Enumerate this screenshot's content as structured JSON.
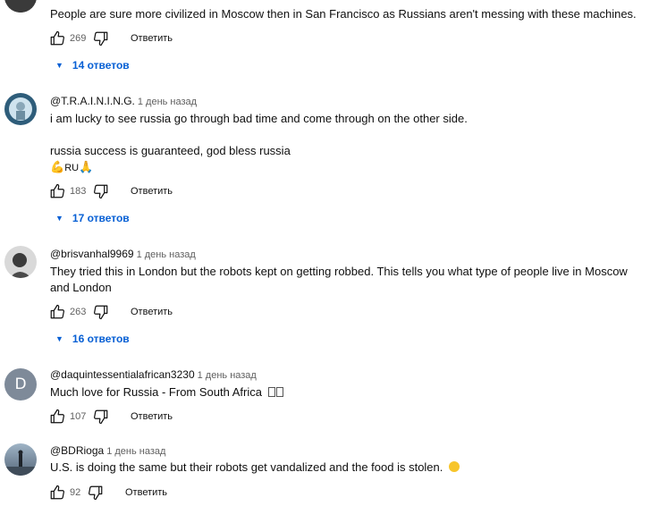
{
  "comments": [
    {
      "author": "",
      "time": "",
      "text": "People are sure more civilized in Moscow then in San Francisco as Russians aren't messing with these machines.",
      "likes": "269",
      "reply_label": "Ответить",
      "replies_label": "14 ответов"
    },
    {
      "author": "@T.R.A.I.N.I.N.G.",
      "time": "1 день назад",
      "text_line1": "i am lucky to see russia go through bad time and come through on the other side.",
      "text_line2": "russia success is guaranteed, god bless russia",
      "text_line3": "RU",
      "likes": "183",
      "reply_label": "Ответить",
      "replies_label": "17 ответов"
    },
    {
      "author": "@brisvanhal9969",
      "time": "1 день назад",
      "text": "They tried this in London but the robots kept on getting robbed. This tells you what type of people live in Moscow and London",
      "likes": "263",
      "reply_label": "Ответить",
      "replies_label": "16 ответов"
    },
    {
      "author": "@daquintessentialafrican3230",
      "time": "1 день назад",
      "avatar_letter": "D",
      "text": "Much love for Russia - From South Africa",
      "likes": "107",
      "reply_label": "Ответить"
    },
    {
      "author": "@BDRioga",
      "time": "1 день назад",
      "text": "U.S. is doing the same but their robots get vandalized and the food is stolen.",
      "likes": "92",
      "reply_label": "Ответить"
    }
  ],
  "colors": {
    "link": "#065fd4",
    "secondary": "#606060",
    "text": "#0f0f0f"
  },
  "icons": [
    "like-icon",
    "dislike-icon",
    "expand-replies-icon",
    "flexed-biceps-emoji",
    "praying-hands-emoji",
    "grinning-emoji"
  ]
}
